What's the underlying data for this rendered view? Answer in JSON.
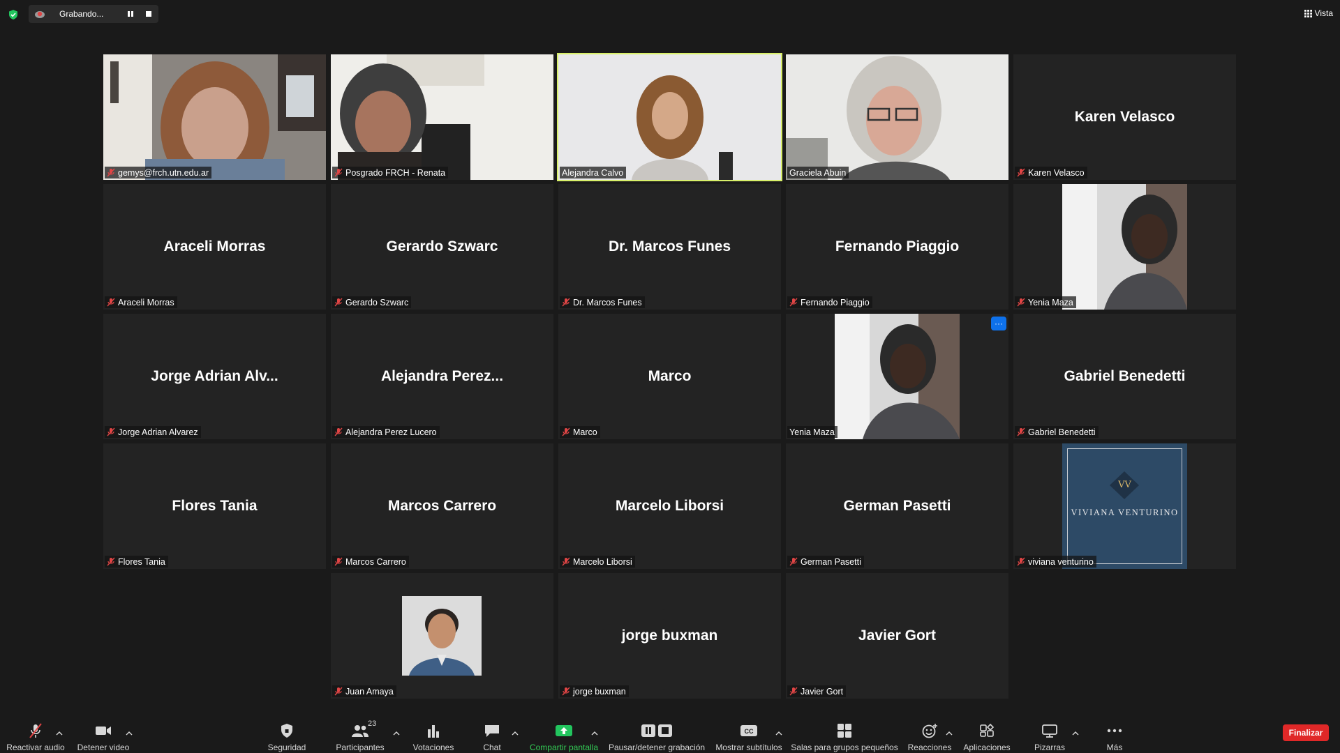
{
  "top_bar": {
    "recording_label": "Grabando...",
    "view_label": "Vista"
  },
  "tiles": [
    {
      "display_name": "",
      "label": "gemys@frch.utn.edu.ar"
    },
    {
      "display_name": "",
      "label": "Posgrado FRCH - Renata"
    },
    {
      "display_name": "",
      "label": "Alejandra Calvo"
    },
    {
      "display_name": "",
      "label": "Graciela Abuin"
    },
    {
      "display_name": "Karen Velasco",
      "label": "Karen Velasco"
    },
    {
      "display_name": "Araceli Morras",
      "label": "Araceli Morras"
    },
    {
      "display_name": "Gerardo Szwarc",
      "label": "Gerardo Szwarc"
    },
    {
      "display_name": "Dr. Marcos Funes",
      "label": "Dr. Marcos Funes"
    },
    {
      "display_name": "Fernando Piaggio",
      "label": "Fernando Piaggio"
    },
    {
      "display_name": "",
      "label": "Yenia Maza"
    },
    {
      "display_name": "Jorge Adrian Alv...",
      "label": "Jorge Adrian Alvarez"
    },
    {
      "display_name": "Alejandra Perez...",
      "label": "Alejandra Perez Lucero"
    },
    {
      "display_name": "Marco",
      "label": "Marco"
    },
    {
      "display_name": "",
      "label": "Yenia Maza",
      "more_button": "···"
    },
    {
      "display_name": "Gabriel Benedetti",
      "label": "Gabriel Benedetti"
    },
    {
      "display_name": "Flores Tania",
      "label": "Flores Tania"
    },
    {
      "display_name": "Marcos Carrero",
      "label": "Marcos Carrero"
    },
    {
      "display_name": "Marcelo Liborsi",
      "label": "Marcelo Liborsi"
    },
    {
      "display_name": "German Pasetti",
      "label": "German Pasetti"
    },
    {
      "display_name": "",
      "label": "viviana venturino",
      "logo_text": "VIVIANA VENTURINO",
      "logo_monogram": "VV"
    },
    {
      "display_name": "",
      "label": "Juan Amaya"
    },
    {
      "display_name": "jorge buxman",
      "label": "jorge buxman"
    },
    {
      "display_name": "Javier Gort",
      "label": "Javier Gort"
    }
  ],
  "toolbar": {
    "audio": "Reactivar audio",
    "video": "Detener video",
    "security": "Seguridad",
    "participants": "Participantes",
    "participants_count": "23",
    "polls": "Votaciones",
    "chat": "Chat",
    "share": "Compartir pantalla",
    "record": "Pausar/detener grabación",
    "captions": "Mostrar subtítulos",
    "breakout": "Salas para grupos pequeños",
    "reactions": "Reacciones",
    "apps": "Aplicaciones",
    "whiteboards": "Pizarras",
    "more": "Más",
    "end": "Finalizar"
  },
  "colors": {
    "active_speaker": "#d9f06a",
    "share_green": "#33cc55",
    "end_red": "#e02828",
    "mute_red": "#e04545",
    "more_blue": "#0e71eb"
  }
}
